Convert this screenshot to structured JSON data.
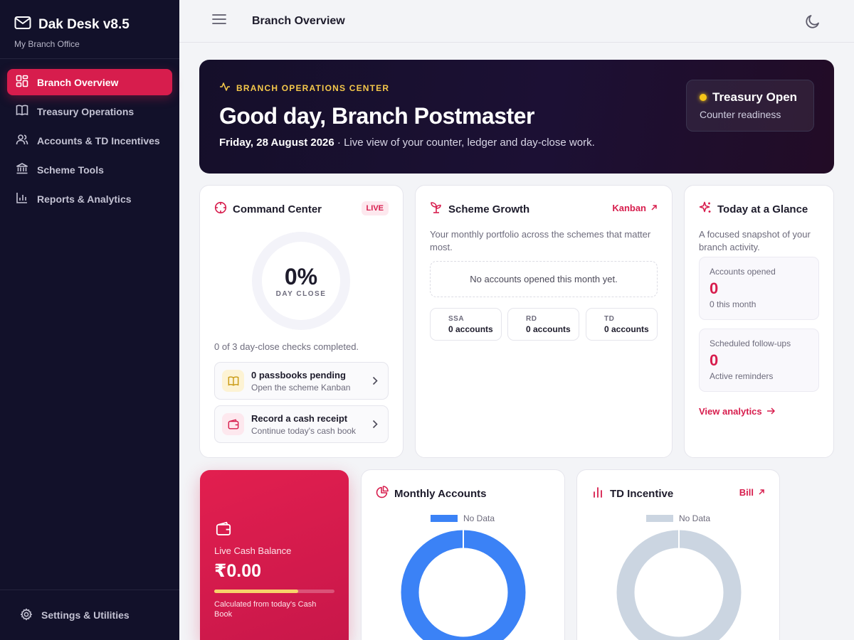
{
  "brand": {
    "title": "Dak Desk v8.5",
    "subtitle": "My Branch Office"
  },
  "sidebar": {
    "items": [
      {
        "label": "Branch Overview",
        "icon": "dashboard-icon",
        "active": true
      },
      {
        "label": "Treasury Operations",
        "icon": "book-icon"
      },
      {
        "label": "Accounts & TD Incentives",
        "icon": "users-icon"
      },
      {
        "label": "Scheme Tools",
        "icon": "bank-icon"
      },
      {
        "label": "Reports & Analytics",
        "icon": "bar-chart-icon"
      }
    ],
    "footer": {
      "label": "Settings & Utilities",
      "icon": "gear-icon"
    }
  },
  "topbar": {
    "title": "Branch Overview"
  },
  "hero": {
    "kicker": "BRANCH OPERATIONS CENTER",
    "title": "Good day, Branch Postmaster",
    "date": "Friday, 28 August 2026",
    "subtitle": " · Live view of your counter, ledger and day-close work.",
    "status": {
      "title": "Treasury Open",
      "subtitle": "Counter readiness",
      "color": "#f5c518"
    }
  },
  "command_center": {
    "title": "Command Center",
    "badge": "LIVE",
    "percent": "0%",
    "percent_value": 0,
    "percent_label": "DAY CLOSE",
    "checks_text": "0 of 3 day-close checks completed.",
    "actions": [
      {
        "title": "0 passbooks pending",
        "subtitle": "Open the scheme Kanban"
      },
      {
        "title": "Record a cash receipt",
        "subtitle": "Continue today's cash book"
      }
    ]
  },
  "scheme_growth": {
    "title": "Scheme Growth",
    "link": "Kanban",
    "description": "Your monthly portfolio across the schemes that matter most.",
    "empty": "No accounts opened this month yet.",
    "schemes": [
      {
        "name": "SSA",
        "value": "0 accounts"
      },
      {
        "name": "RD",
        "value": "0 accounts"
      },
      {
        "name": "TD",
        "value": "0 accounts"
      }
    ]
  },
  "today": {
    "title": "Today at a Glance",
    "description": "A focused snapshot of your branch activity.",
    "stats": [
      {
        "label": "Accounts opened",
        "value": "0",
        "sub": "0 this month"
      },
      {
        "label": "Scheduled follow-ups",
        "value": "0",
        "sub": "Active reminders"
      }
    ],
    "link": "View analytics"
  },
  "cash": {
    "label": "Live Cash Balance",
    "value": "₹0.00",
    "progress": 0.7,
    "note": "Calculated from today's Cash Book"
  },
  "monthly_accounts": {
    "title": "Monthly Accounts",
    "legend": "No Data",
    "color": "#3b82f6"
  },
  "td_incentive": {
    "title": "TD Incentive",
    "link": "Bill",
    "legend": "No Data",
    "color": "#cbd5e1"
  },
  "colors": {
    "accent": "#d71d4d",
    "sidebar": "#12112a",
    "gold": "#f5c84a"
  }
}
